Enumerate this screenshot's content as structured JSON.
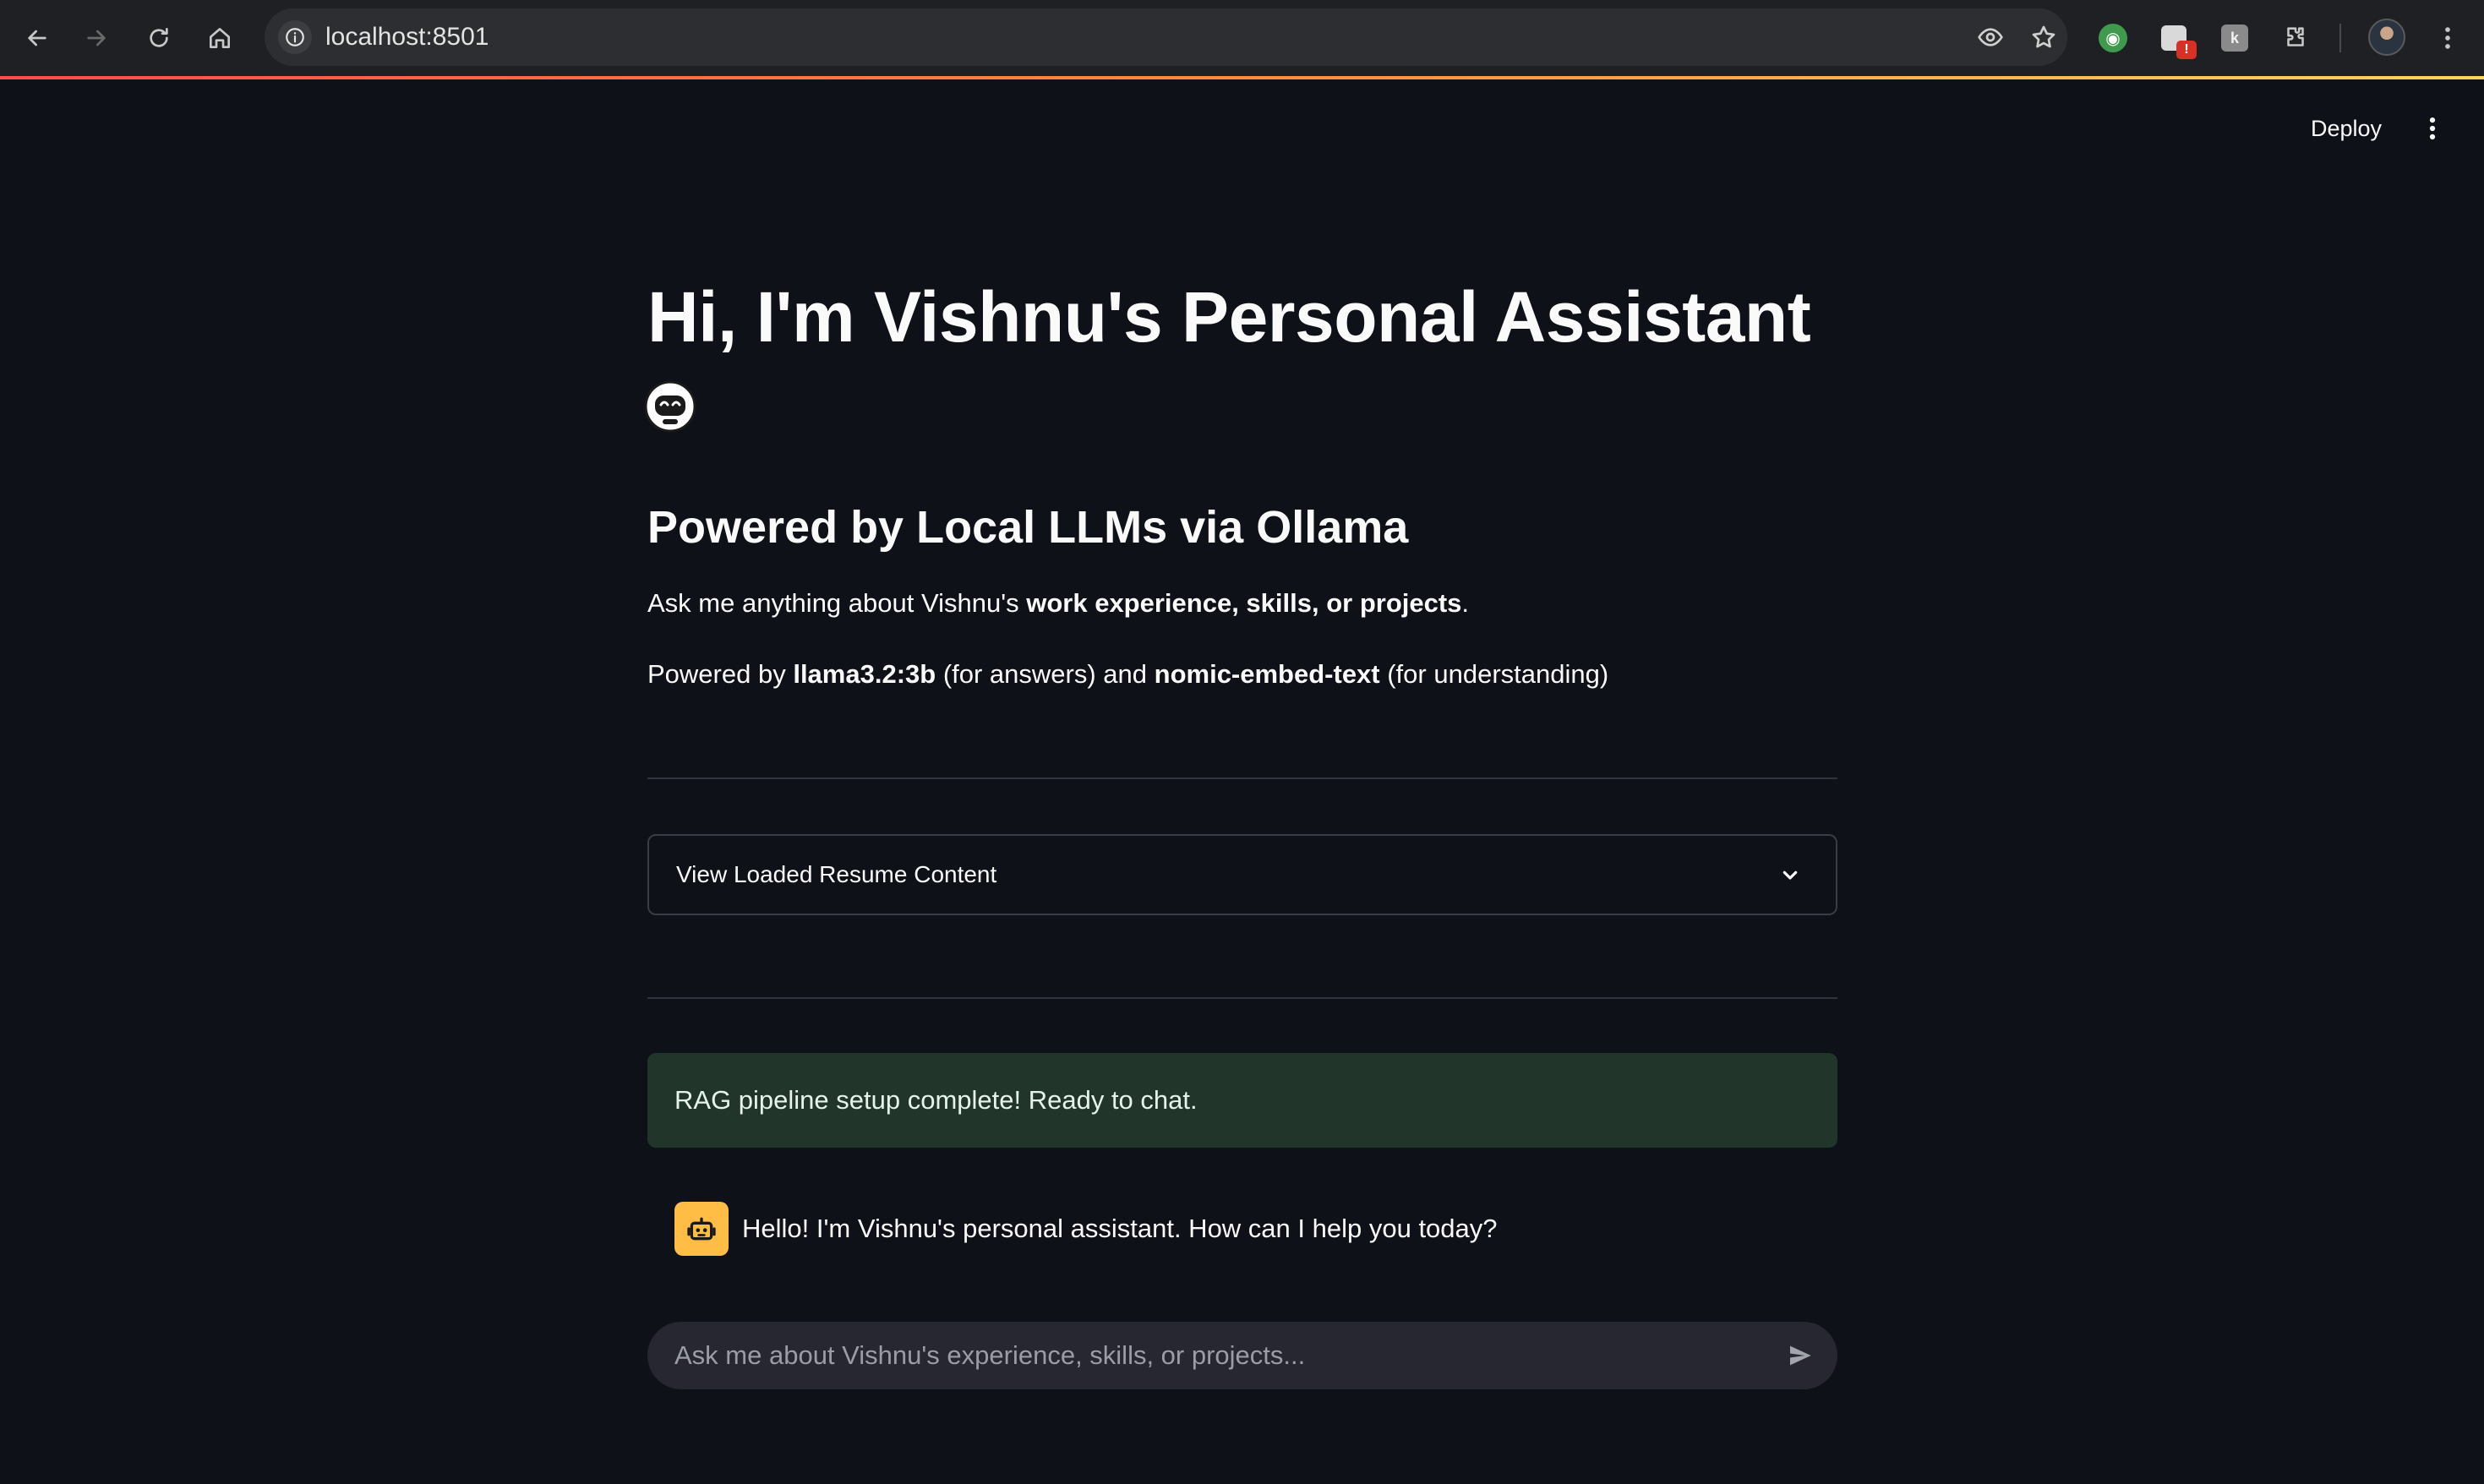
{
  "browser": {
    "url": "localhost:8501",
    "icons": [
      "back-icon",
      "forward-icon",
      "reload-icon",
      "home-icon",
      "site-info-icon",
      "eye-icon",
      "star-icon",
      "extension-puzzle-icon",
      "profile-avatar",
      "kebab-menu-icon"
    ],
    "extension_badge": "!"
  },
  "header": {
    "deploy_label": "Deploy"
  },
  "main": {
    "title": "Hi, I'm Vishnu's Personal Assistant",
    "title_emoji": "robot-face",
    "subtitle": "Powered by Local LLMs via Ollama",
    "para1_prefix": "Ask me anything about Vishnu's ",
    "para1_bold": "work experience, skills, or projects",
    "para1_suffix": ".",
    "para2_part1": "Powered by ",
    "para2_bold1": "llama3.2:3b",
    "para2_part2": " (for answers) and ",
    "para2_bold2": "nomic-embed-text",
    "para2_part3": " (for understanding)",
    "expander_label": "View Loaded Resume Content",
    "success_message": "RAG pipeline setup complete! Ready to chat.",
    "assistant_message": "Hello! I'm Vishnu's personal assistant. How can I help you today?",
    "chat_placeholder": "Ask me about Vishnu's experience, skills, or projects..."
  },
  "colors": {
    "background": "#0e1117",
    "success_bg": "#21352b",
    "assistant_avatar": "#ffbd45",
    "input_bg": "#262730",
    "accent_gradient_start": "#ff4b4b"
  }
}
